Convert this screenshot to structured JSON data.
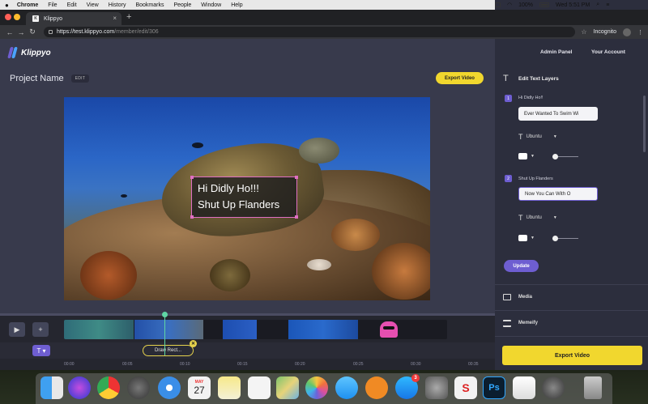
{
  "menubar": {
    "apple": "",
    "items": [
      "Chrome",
      "File",
      "Edit",
      "View",
      "History",
      "Bookmarks",
      "People",
      "Window",
      "Help"
    ],
    "battery": "100%",
    "day_time": "Wed 5:51 PM"
  },
  "browser": {
    "tab_title": "Klippyo",
    "tab_favicon": "K",
    "url_host": "https://test.klippyo.com",
    "url_path": "/member/edit/306",
    "profile": "Incognito"
  },
  "app": {
    "logo_text": "Klippyo",
    "project_name": "Project Name",
    "edit_label": "EDIT",
    "export_top": "Export Video",
    "overlay_line1": "Hi Didly Ho!!!",
    "overlay_line2": "Shut Up Flanders",
    "timeline": {
      "play_icon": "▶",
      "add_icon": "+",
      "text_tool": "T ▾",
      "draw_rect": "Draw Rect...",
      "draw_close": "✕",
      "ticks": [
        "00:00",
        "00:05",
        "00:10",
        "00:15",
        "00:20",
        "00:25",
        "00:30",
        "00:35"
      ]
    },
    "panel": {
      "admin": "Admin Panel",
      "account": "Your Account",
      "edit_text_layers": "Edit Text Layers",
      "layers": [
        {
          "num": "1",
          "label": "Hi Didly Ho!!",
          "input": "Ever Wanted To Swim Wi",
          "font": "Ubuntu"
        },
        {
          "num": "2",
          "label": "Shut Up Flanders",
          "input": "Now You Can With O",
          "font": "Ubuntu"
        }
      ],
      "update": "Update",
      "media": "Media",
      "memeify": "Memeify",
      "export_bottom": "Export Video"
    }
  },
  "dock": {
    "calendar_month": "MAY",
    "calendar_day": "27",
    "appstore_badge": "3"
  },
  "colors": {
    "accent_purple": "#6e5ed1",
    "accent_yellow": "#f1d72e",
    "panel_bg": "#2c2e3d",
    "editor_bg": "#383a4c"
  }
}
